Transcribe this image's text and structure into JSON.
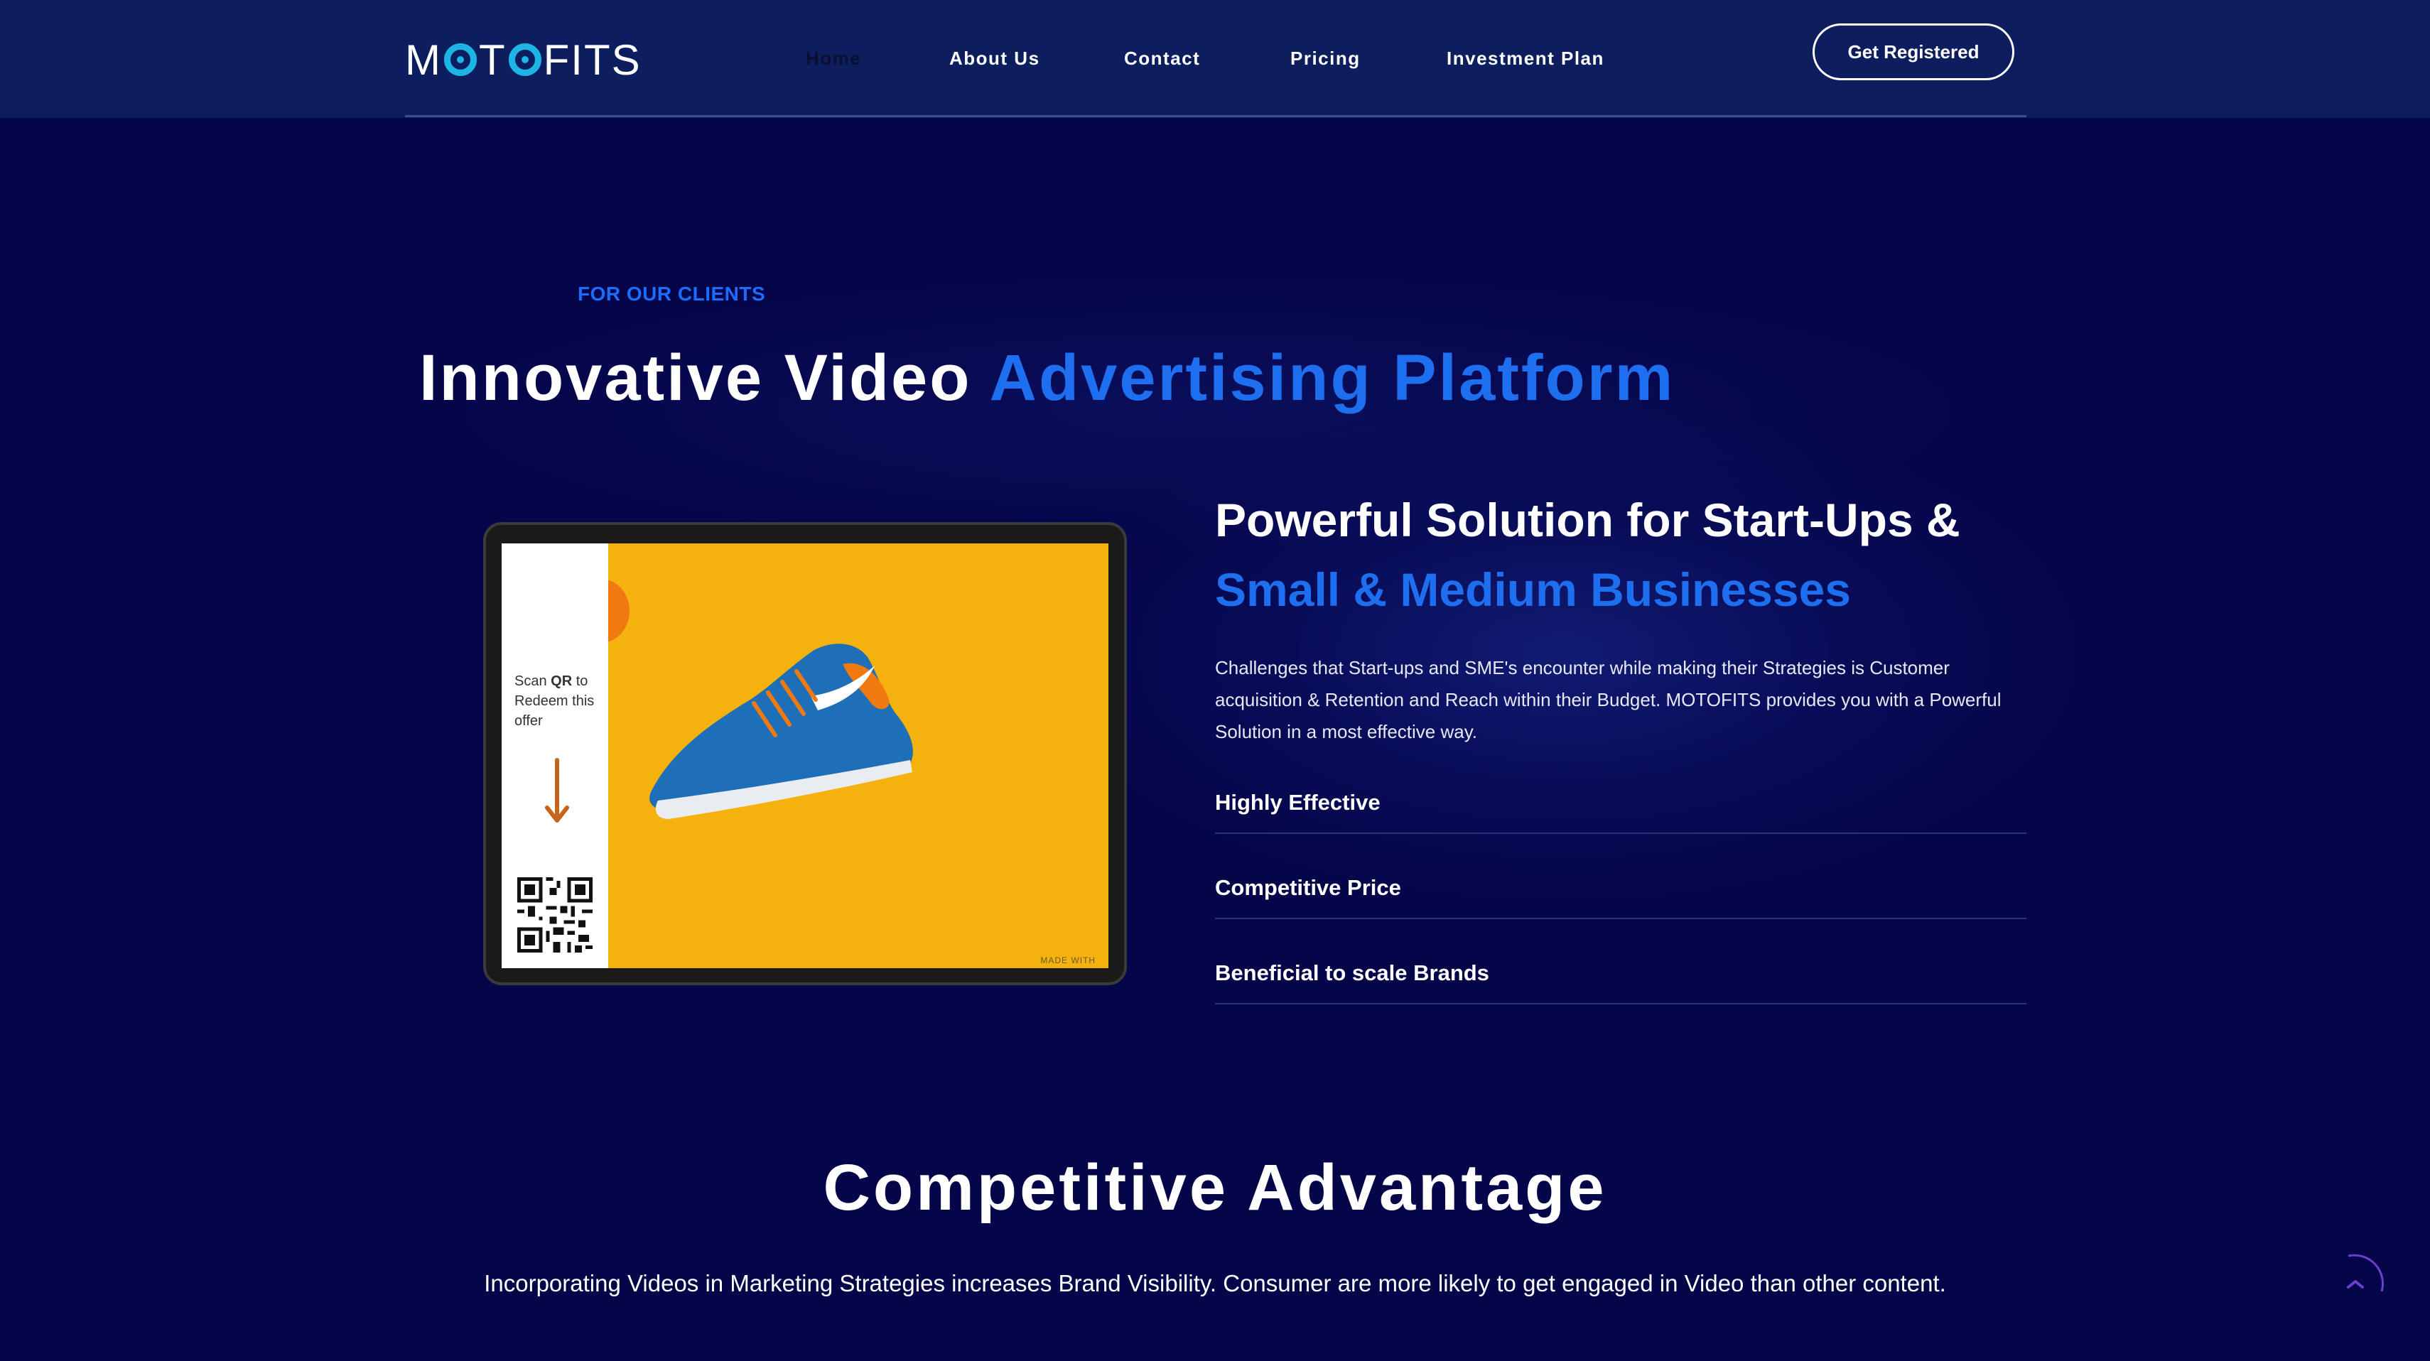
{
  "header": {
    "logo": {
      "pre": "M",
      "post": "T",
      "tail": "FITS"
    },
    "nav": [
      {
        "label": "Home",
        "active": true
      },
      {
        "label": "About Us",
        "active": false
      },
      {
        "label": "Contact",
        "active": false
      },
      {
        "label": "Pricing",
        "active": false
      },
      {
        "label": "Investment Plan",
        "active": false
      }
    ],
    "cta_label": "Get Registered"
  },
  "hero": {
    "eyebrow": "FOR OUR CLIENTS",
    "title_plain": "Innovative Video ",
    "title_accent": "Advertising Platform"
  },
  "tablet": {
    "scan_text_1": "Scan ",
    "scan_text_bold": "QR",
    "scan_text_2": " to Redeem this offer",
    "footer_text": "MADE WITH"
  },
  "solution": {
    "title_line1": "Powerful Solution for Start-Ups &",
    "title_line2": "Small & Medium Businesses",
    "description": "Challenges that Start-ups and SME's encounter while making their Strategies is Customer acquisition & Retention and Reach within their Budget. MOTOFITS provides you with a Powerful Solution in a most effective way.",
    "features": [
      "Highly Effective",
      "Competitive Price",
      "Beneficial to scale Brands"
    ]
  },
  "advantage": {
    "title": "Competitive Advantage",
    "description": "Incorporating Videos in Marketing Strategies increases Brand Visibility. Consumer are more likely to get engaged in Video than other content."
  },
  "colors": {
    "background": "#05054a",
    "header": "#0c1e5e",
    "accent": "#1e6ff0",
    "logo_accent": "#1cb5e6",
    "tablet_screen": "#f5b20e"
  },
  "icons": [
    "logo-o-icon",
    "arrow-down-icon",
    "qr-code-icon",
    "shoe-image",
    "scroll-top-icon"
  ]
}
